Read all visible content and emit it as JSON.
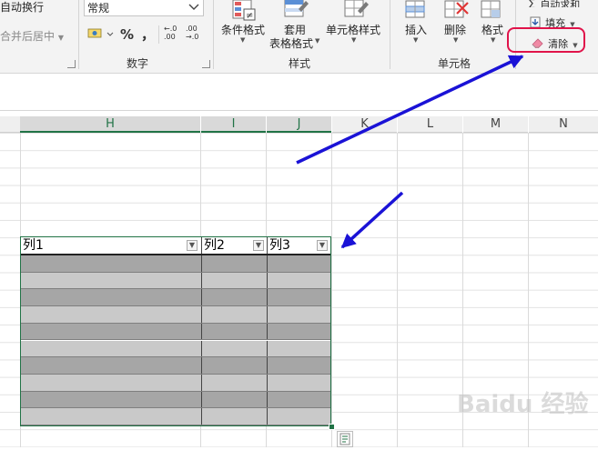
{
  "ribbon": {
    "wrap_text": "自动换行",
    "merge_center": "合并后居中",
    "number_format": "常规",
    "group_number": "数字",
    "conditional_format": "条件格式",
    "table_format_line1": "套用",
    "table_format_line2": "表格格式",
    "cell_styles": "单元格样式",
    "group_styles": "样式",
    "insert": "插入",
    "delete": "删除",
    "format": "格式",
    "group_cells": "单元格",
    "autosum": "自动求和",
    "fill": "填充",
    "clear": "清除",
    "percent_symbol": "%",
    "comma_symbol": "，",
    "increase_decimal": "←.0\n.00",
    "decrease_decimal": ".00\n→.0"
  },
  "columns": [
    "H",
    "I",
    "J",
    "K",
    "L",
    "M",
    "N"
  ],
  "selected_columns": [
    "H",
    "I",
    "J"
  ],
  "table": {
    "headers": [
      "列1",
      "列2",
      "列3"
    ],
    "row_count": 10
  },
  "colors": {
    "excel_green": "#217346",
    "highlight_red": "#e0134a",
    "arrow_blue": "#1a12d6",
    "row_dark": "#a6a6a6",
    "row_light": "#c9c9c9"
  },
  "watermark": "Baidu 经验"
}
